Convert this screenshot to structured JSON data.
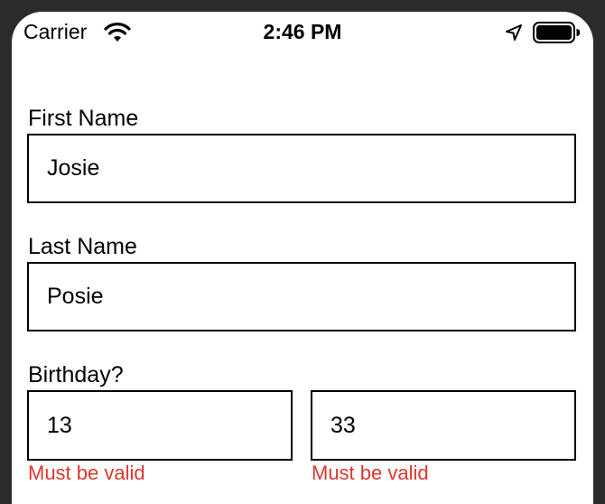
{
  "status_bar": {
    "carrier": "Carrier",
    "time": "2:46 PM",
    "icons": [
      "wifi-icon",
      "location-arrow-icon",
      "battery-icon"
    ]
  },
  "form": {
    "first_name": {
      "label": "First Name",
      "value": "Josie"
    },
    "last_name": {
      "label": "Last Name",
      "value": "Posie"
    },
    "birthday": {
      "label": "Birthday?",
      "fields": [
        {
          "value": "13",
          "error": "Must be valid"
        },
        {
          "value": "33",
          "error": "Must be valid"
        }
      ]
    }
  },
  "colors": {
    "error": "#e0362c",
    "border": "#000000",
    "background": "#ffffff",
    "frame": "#2b2b2b"
  }
}
